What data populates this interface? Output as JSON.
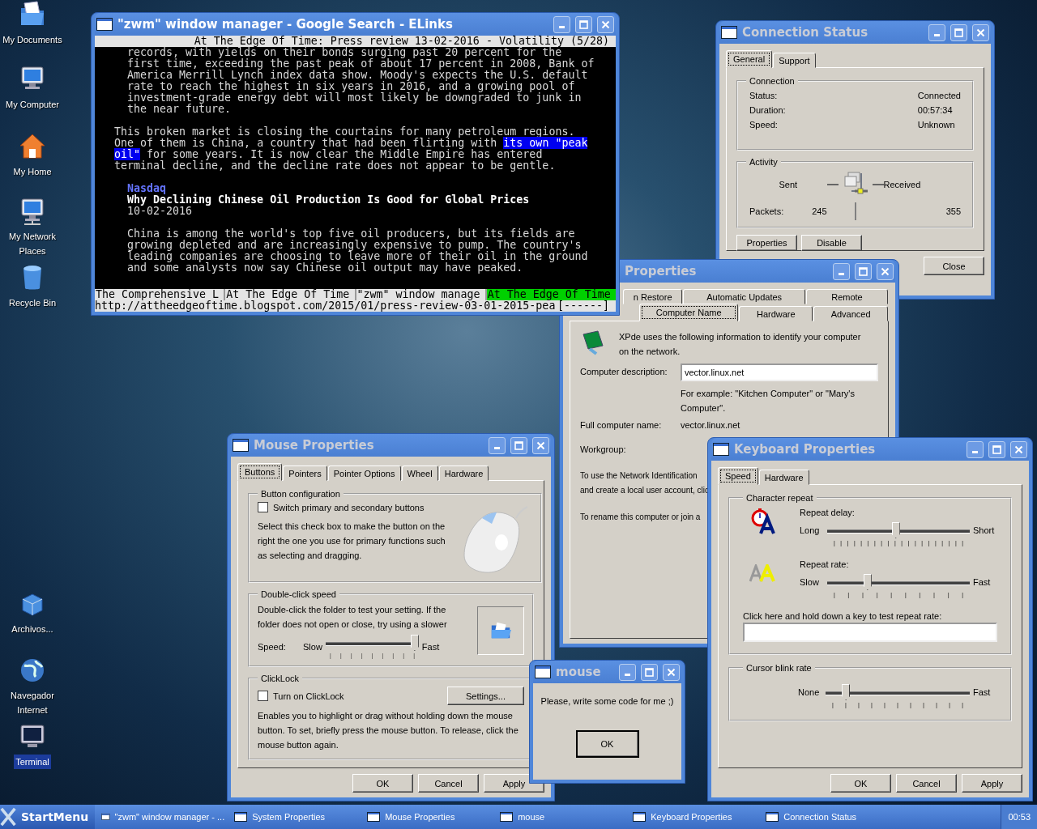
{
  "desktop": {
    "icons": [
      {
        "label": "My Documents",
        "selected": false
      },
      {
        "label": "My Computer",
        "selected": false
      },
      {
        "label": "My Home",
        "selected": false
      },
      {
        "label": "My Network Places",
        "selected": false
      },
      {
        "label": "Recycle Bin",
        "selected": false
      },
      {
        "label": "Archivos...",
        "selected": false
      },
      {
        "label": "Navegador Internet",
        "selected": false
      },
      {
        "label": "Terminal",
        "selected": true
      }
    ]
  },
  "elinks": {
    "title": "\"zwm\" window manager - Google Search - ELinks",
    "active": true,
    "page_title": "At The Edge Of Time: Press review 13-02-2016 - Volatility (5/28)",
    "blocks": [
      {
        "kind": "quote",
        "gap_before": false,
        "lines": [
          "records, with yields on their bonds surging past 20 percent for the",
          "first time, exceeding the past peak of about 17 percent in 2008, Bank of",
          "America Merrill Lynch index data show. Moody's expects the U.S. default",
          "rate to reach the highest in six years in 2016, and a growing pool of",
          "investment-grade energy debt will most likely be downgraded to junk in",
          "the near future."
        ]
      },
      {
        "kind": "body",
        "gap_before": true,
        "lines": [
          "This broken market is closing the courtains for many petroleum regions.",
          {
            "parts": [
              {
                "text": "One of them is China, a country that had been flirting with ",
                "highlighted": false
              },
              {
                "text": "its own \"peak",
                "highlighted": true
              }
            ]
          },
          {
            "parts": [
              {
                "text": "oil\"",
                "highlighted": true
              },
              {
                "text": " for some years. It is now clear the Middle Empire has entered",
                "highlighted": false
              }
            ]
          },
          "terminal decline, and the decline rate does not appear to be gentle."
        ]
      },
      {
        "kind": "source",
        "gap_before": true,
        "lines": [
          "Nasdaq"
        ]
      },
      {
        "kind": "headline",
        "gap_before": false,
        "lines": [
          "Why Declining Chinese Oil Production Is Good for Global Prices"
        ]
      },
      {
        "kind": "quote",
        "gap_before": false,
        "lines": [
          "10-02-2016"
        ]
      },
      {
        "kind": "quote",
        "gap_before": true,
        "lines": [
          "China is among the world's top five oil producers, but its fields are",
          "growing depleted and are increasingly expensive to pump. The country's",
          "leading companies are choosing to leave more of their oil in the ground",
          "and some analysts now say Chinese oil output may have peaked."
        ]
      }
    ],
    "tabs": [
      {
        "label": "The Comprehensive L",
        "selected": false
      },
      {
        "label": "At The Edge Of Time",
        "selected": false
      },
      {
        "label": "\"zwm\" window manage",
        "selected": false
      },
      {
        "label": "At The Edge Of Time",
        "selected": true
      }
    ],
    "url": "http://attheedgeoftime.blogspot.com/2015/01/press-review-03-01-2015-pea",
    "progress": "[------]"
  },
  "connection_status": {
    "title": "Connection Status",
    "active": false,
    "tabs": [
      {
        "label": "General",
        "selected": true
      },
      {
        "label": "Support",
        "selected": false
      }
    ],
    "connection": {
      "label": "Connection",
      "rows": [
        {
          "label": "Status:",
          "value": "Connected"
        },
        {
          "label": "Duration:",
          "value": "00:57:34"
        },
        {
          "label": "Speed:",
          "value": "Unknown"
        }
      ]
    },
    "activity": {
      "label": "Activity",
      "sent": "Sent",
      "received": "Received",
      "packets_label": "Packets:",
      "packets_sent": "245",
      "packets_received": "355"
    },
    "buttons": [
      "Properties",
      "Disable"
    ],
    "close": "Close"
  },
  "system_properties": {
    "title": "Properties",
    "active": false,
    "tab_rows": [
      [
        {
          "label": "n Restore",
          "selected": false
        },
        {
          "label": "Automatic Updates",
          "selected": false
        },
        {
          "label": "Remote",
          "selected": false
        }
      ],
      [
        {
          "label": "Computer Name",
          "selected": true
        },
        {
          "label": "Hardware",
          "selected": false
        },
        {
          "label": "Advanced",
          "selected": false
        }
      ]
    ],
    "intro": "XPde uses the following information to identify your computer on the network.",
    "description_label": "Computer description:",
    "description_value": "vector.linux.net",
    "example": "For example: \"Kitchen Computer\" or \"Mary's Computer\".",
    "full_name_label": "Full computer name:",
    "full_name": "vector.linux.net",
    "workgroup_label": "Workgroup:",
    "network_id_lines": [
      "To use the Network Identification",
      "and create a local user account, clic"
    ],
    "rename_text": "To rename this computer or join a"
  },
  "mouse_properties": {
    "title": "Mouse Properties",
    "active": false,
    "tabs": [
      {
        "label": "Buttons",
        "selected": true
      },
      {
        "label": "Pointers",
        "selected": false
      },
      {
        "label": "Pointer Options",
        "selected": false
      },
      {
        "label": "Wheel",
        "selected": false
      },
      {
        "label": "Hardware",
        "selected": false
      }
    ],
    "button_config": {
      "label": "Button configuration",
      "checkbox": {
        "label": "Switch primary and secondary buttons",
        "checked": false
      },
      "description": "Select this check box to make the button on the right the one you use for primary functions such as selecting and dragging."
    },
    "double_click": {
      "label": "Double-click speed",
      "description": "Double-click the folder to test your setting. If the folder does not open or close, try using a slower",
      "speed_label": "Speed:",
      "min_label": "Slow",
      "max_label": "Fast",
      "level": 1.0
    },
    "clicklock": {
      "label": "ClickLock",
      "checkbox": {
        "label": "Turn on ClickLock",
        "checked": false
      },
      "settings_button": "Settings...",
      "description": "Enables you to highlight or drag without holding down the mouse button. To set, briefly press the mouse button. To release, click the mouse button again."
    },
    "buttons": [
      "OK",
      "Cancel",
      "Apply"
    ]
  },
  "mouse_message": {
    "title": "mouse",
    "active": false,
    "message": "Please, write some code for me ;)",
    "button": "OK"
  },
  "keyboard_properties": {
    "title": "Keyboard Properties",
    "active": false,
    "tabs": [
      {
        "label": "Speed",
        "selected": true
      },
      {
        "label": "Hardware",
        "selected": false
      }
    ],
    "character_repeat": {
      "label": "Character repeat",
      "sliders": [
        {
          "label": "Repeat delay:",
          "min_label": "Long",
          "max_label": "Short",
          "level": 0.48
        },
        {
          "label": "Repeat rate:",
          "min_label": "Slow",
          "max_label": "Fast",
          "level": 0.27
        }
      ],
      "test_label": "Click here and hold down a key to test repeat rate:"
    },
    "cursor_blink": {
      "label": "Cursor blink rate",
      "min_label": "None",
      "max_label": "Fast",
      "level": 0.12
    },
    "buttons": [
      "OK",
      "Cancel",
      "Apply"
    ]
  },
  "taskbar": {
    "start": "StartMenu",
    "tasks": [
      "\"zwm\" window manager - ...",
      "System Properties",
      "Mouse Properties",
      "mouse",
      "Keyboard Properties",
      "Connection Status"
    ],
    "clock": "00:53"
  }
}
